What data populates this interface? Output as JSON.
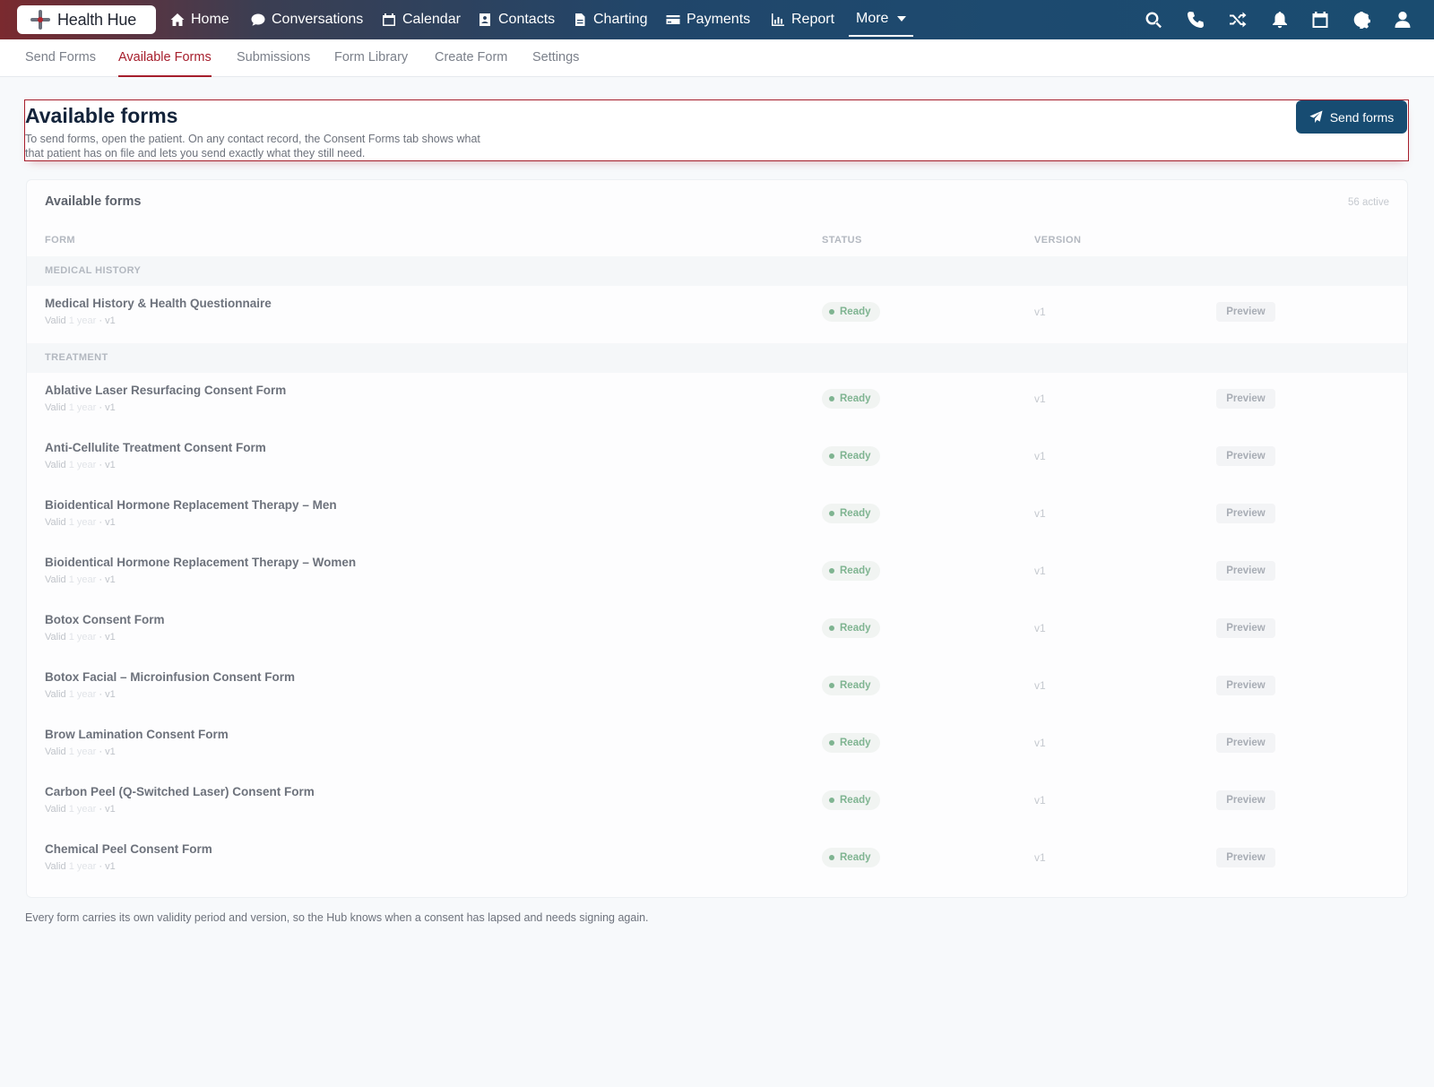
{
  "brand": {
    "name": "Health Hue"
  },
  "nav": {
    "items": [
      {
        "label": "Home",
        "icon": "home-icon"
      },
      {
        "label": "Conversations",
        "icon": "chat-icon"
      },
      {
        "label": "Calendar",
        "icon": "calendar-icon"
      },
      {
        "label": "Contacts",
        "icon": "contact-card-icon"
      },
      {
        "label": "Charting",
        "icon": "document-icon"
      },
      {
        "label": "Payments",
        "icon": "credit-card-icon"
      },
      {
        "label": "Report",
        "icon": "bar-chart-icon"
      }
    ],
    "more_label": "More",
    "right_icons": [
      "search-icon",
      "phone-icon",
      "shuffle-icon",
      "bell-icon",
      "calendar-icon",
      "gear-icon",
      "user-icon"
    ]
  },
  "subtabs": {
    "items": [
      "Send Forms",
      "Available Forms",
      "Submissions",
      "Form Library",
      "Create Form",
      "Settings"
    ],
    "active": "Available Forms"
  },
  "header": {
    "title": "Available forms",
    "description": "To send forms, open the patient. On any contact record, the Consent Forms tab shows what that patient has on file and lets you send exactly what they still need.",
    "send_button": "Send forms"
  },
  "card": {
    "title": "Available forms",
    "count": "56 active",
    "columns": {
      "form": "FORM",
      "status": "STATUS",
      "version": "VERSION"
    },
    "groups": [
      {
        "label": "MEDICAL HISTORY",
        "rows": [
          {
            "name": "Medical History & Health Questionnaire",
            "meta_valid": "Valid",
            "meta_period": "1 year",
            "meta_version": "· v1",
            "status": "Ready",
            "version": "v1",
            "action": "Preview"
          }
        ]
      },
      {
        "label": "TREATMENT",
        "rows": [
          {
            "name": "Ablative Laser Resurfacing Consent Form",
            "meta_valid": "Valid",
            "meta_period": "1 year",
            "meta_version": "· v1",
            "status": "Ready",
            "version": "v1",
            "action": "Preview"
          },
          {
            "name": "Anti-Cellulite Treatment Consent Form",
            "meta_valid": "Valid",
            "meta_period": "1 year",
            "meta_version": "· v1",
            "status": "Ready",
            "version": "v1",
            "action": "Preview"
          },
          {
            "name": "Bioidentical Hormone Replacement Therapy – Men",
            "meta_valid": "Valid",
            "meta_period": "1 year",
            "meta_version": "· v1",
            "status": "Ready",
            "version": "v1",
            "action": "Preview"
          },
          {
            "name": "Bioidentical Hormone Replacement Therapy – Women",
            "meta_valid": "Valid",
            "meta_period": "1 year",
            "meta_version": "· v1",
            "status": "Ready",
            "version": "v1",
            "action": "Preview"
          },
          {
            "name": "Botox Consent Form",
            "meta_valid": "Valid",
            "meta_period": "1 year",
            "meta_version": "· v1",
            "status": "Ready",
            "version": "v1",
            "action": "Preview"
          },
          {
            "name": "Botox Facial – Microinfusion Consent Form",
            "meta_valid": "Valid",
            "meta_period": "1 year",
            "meta_version": "· v1",
            "status": "Ready",
            "version": "v1",
            "action": "Preview"
          },
          {
            "name": "Brow Lamination Consent Form",
            "meta_valid": "Valid",
            "meta_period": "1 year",
            "meta_version": "· v1",
            "status": "Ready",
            "version": "v1",
            "action": "Preview"
          },
          {
            "name": "Carbon Peel (Q-Switched Laser) Consent Form",
            "meta_valid": "Valid",
            "meta_period": "1 year",
            "meta_version": "· v1",
            "status": "Ready",
            "version": "v1",
            "action": "Preview"
          },
          {
            "name": "Chemical Peel Consent Form",
            "meta_valid": "Valid",
            "meta_period": "1 year",
            "meta_version": "· v1",
            "status": "Ready",
            "version": "v1",
            "action": "Preview"
          }
        ]
      }
    ]
  },
  "footnote": "Every form carries its own validity period and version, so the Hub knows when a consent has lapsed and needs signing again.",
  "colors": {
    "accent": "#a61e2c",
    "primary_button": "#174c72",
    "ready": "#7fb491"
  }
}
